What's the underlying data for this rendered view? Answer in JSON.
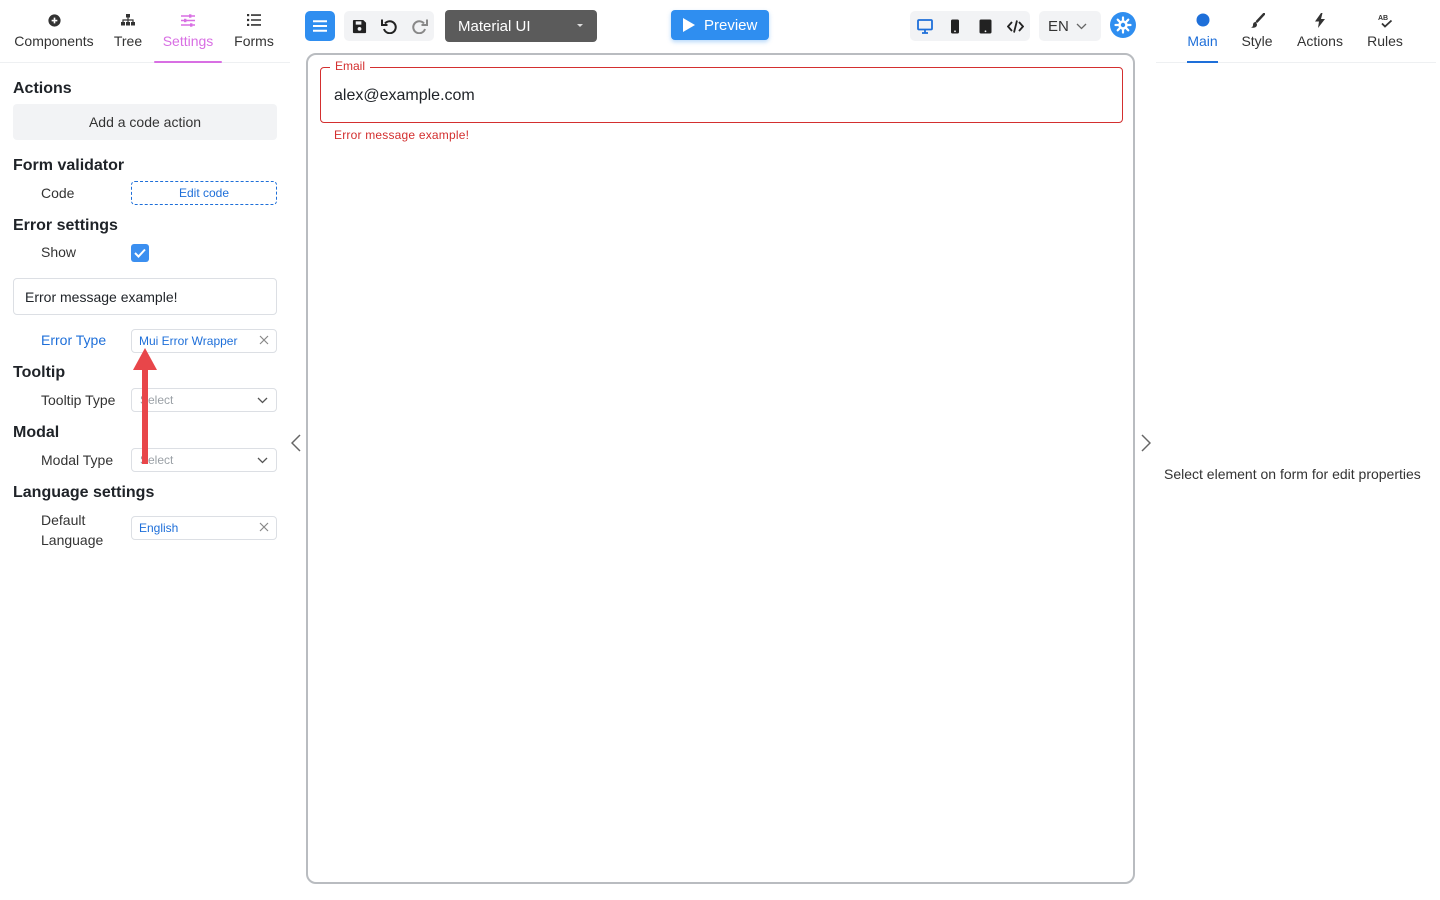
{
  "left_tabs": [
    {
      "label": "Components",
      "icon": "plus-circle-icon"
    },
    {
      "label": "Tree",
      "icon": "sitemap-icon"
    },
    {
      "label": "Settings",
      "icon": "sliders-icon"
    },
    {
      "label": "Forms",
      "icon": "list-icon"
    }
  ],
  "settings": {
    "actions": {
      "title": "Actions",
      "add_button": "Add a code action"
    },
    "form_validator": {
      "title": "Form validator",
      "code_label": "Code",
      "edit_button": "Edit code"
    },
    "error_settings": {
      "title": "Error settings",
      "show_label": "Show",
      "show_checked": true,
      "message_value": "Error message example!",
      "error_type_label": "Error Type",
      "error_type_value": "Mui Error Wrapper"
    },
    "tooltip": {
      "title": "Tooltip",
      "type_label": "Tooltip Type",
      "type_placeholder": "Select"
    },
    "modal": {
      "title": "Modal",
      "type_label": "Modal Type",
      "type_placeholder": "Select"
    },
    "language": {
      "title": "Language settings",
      "default_label_line1": "Default",
      "default_label_line2": "Language",
      "default_value": "English"
    }
  },
  "toolbar": {
    "theme": "Material UI",
    "preview": "Preview",
    "language": "EN"
  },
  "canvas": {
    "email_label": "Email",
    "email_value": "alex@example.com",
    "error_text": "Error message example!"
  },
  "right_tabs": [
    {
      "label": "Main",
      "icon": "circle-icon"
    },
    {
      "label": "Style",
      "icon": "brush-icon"
    },
    {
      "label": "Actions",
      "icon": "bolt-icon"
    },
    {
      "label": "Rules",
      "icon": "spellcheck-icon"
    }
  ],
  "right_panel": {
    "empty_message": "Select element on form for edit properties"
  },
  "colors": {
    "accent": "#2f8ef0",
    "settings_tab": "#d86fe3",
    "error": "#d32f2f",
    "link": "#1e6fd9",
    "annotation_arrow": "#e8464a"
  }
}
